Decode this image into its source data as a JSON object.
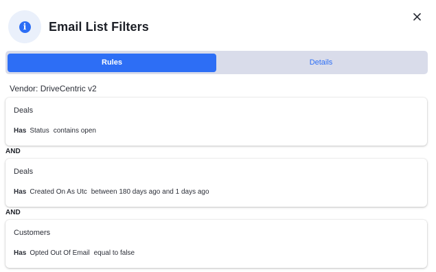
{
  "header": {
    "title": "Email List Filters",
    "info_icon": "info-icon",
    "close_icon": "close-icon",
    "close_glyph": "✕"
  },
  "tabs": [
    {
      "label": "Rules",
      "active": true
    },
    {
      "label": "Details",
      "active": false
    }
  ],
  "vendor": "Vendor: DriveCentric v2",
  "rules": [
    {
      "entity": "Deals",
      "has": "Has",
      "field": "Status",
      "condition": "contains open"
    },
    {
      "entity": "Deals",
      "has": "Has",
      "field": "Created On As Utc",
      "condition": "between 180 days ago and 1 days ago"
    },
    {
      "entity": "Customers",
      "has": "Has",
      "field": "Opted Out Of Email",
      "condition": "equal to false"
    }
  ],
  "connectors": [
    "AND",
    "AND"
  ],
  "colors": {
    "accent": "#2d6ef5",
    "tab_track": "#d9dcea",
    "info_bg": "#eaf0fb"
  }
}
